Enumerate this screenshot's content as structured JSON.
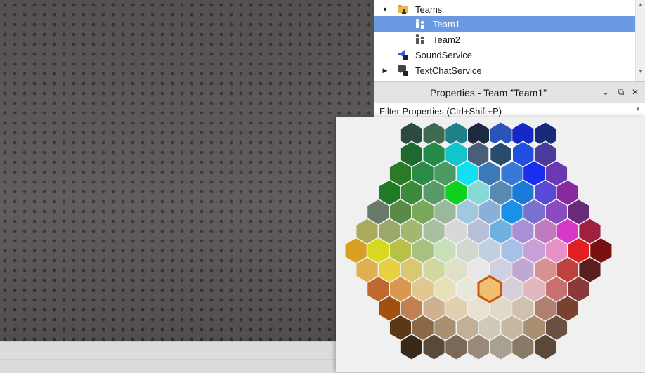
{
  "explorer": {
    "items": [
      {
        "label": "Teams",
        "icon": "teams-folder-icon",
        "expanded": true,
        "selected": false
      },
      {
        "label": "Team1",
        "icon": "team-icon",
        "expanded": null,
        "selected": true
      },
      {
        "label": "Team2",
        "icon": "team-icon",
        "expanded": null,
        "selected": false
      },
      {
        "label": "SoundService",
        "icon": "sound-service-icon",
        "expanded": null,
        "selected": false
      },
      {
        "label": "TextChatService",
        "icon": "text-chat-service-icon",
        "expanded": false,
        "selected": false
      }
    ]
  },
  "properties": {
    "title": "Properties - Team \"Team1\"",
    "filter_placeholder": "Filter Properties (Ctrl+Shift+P)"
  },
  "colors": {
    "selection": "#6b9ae2",
    "viewport": "#5b5558",
    "picker_selected": "#2a4a6e",
    "picker_hover": "#f0c070"
  },
  "color_picker": {
    "selected_swatch": "#2a4a6e",
    "hover_swatch": "#f0c070",
    "rows": [
      [
        "#2d4a3e",
        "#3d6a50",
        "#1f7f8a",
        "#1b2a3c",
        "#2a55b8",
        "#1428c8",
        "#1a2a7a"
      ],
      [
        "#1e6a2e",
        "#238a48",
        "#12c4cc",
        "#4a5e78",
        "#2a4a6e",
        "#2050e0",
        "#4a3a9a"
      ],
      [
        "#2a7a28",
        "#2a8a4a",
        "#4a9a62",
        "#10e0f0",
        "#3a7ab8",
        "#3a78d8",
        "#1a2ef0",
        "#6a38b0"
      ],
      [
        "#1e7a24",
        "#3a8a3a",
        "#5a9a6a",
        "#10d020",
        "#88d8d8",
        "#5a8ab0",
        "#1a7ad8",
        "#5a4ad8",
        "#8a2aa0"
      ],
      [
        "#6a7a6a",
        "#5a8a4a",
        "#7aa85a",
        "#9ab89a",
        "#a0c8e0",
        "#8ab0d8",
        "#1a90e8",
        "#7a70d0",
        "#8a4ac0",
        "#6a2a7a"
      ],
      [
        "#aaaa5a",
        "#9aa86a",
        "#a0b870",
        "#a8c0a0",
        "#d8d8d8",
        "#b8c0d8",
        "#70b0e0",
        "#a890d8",
        "#c07ac0",
        "#d838c8",
        "#a02040"
      ],
      [
        "#d8a020",
        "#d8d820",
        "#b8c048",
        "#a8c080",
        "#c8e0b8",
        "#d0d8d0",
        "#c0d0e0",
        "#a8c0e8",
        "#c8a0d8",
        "#e890c8",
        "#e02020",
        "#7a1010"
      ],
      [
        "#e0b050",
        "#e8d040",
        "#d8c870",
        "#d0d8a0",
        "#e0e0c8",
        "#e8e8e8",
        "#d0d0e0",
        "#c0a8d0",
        "#d89090",
        "#c04040",
        "#5a2020"
      ],
      [
        "#c06830",
        "#d89850",
        "#e0c890",
        "#e8e0b8",
        "#e8e8d8",
        "#f0c070",
        "#d8d0d8",
        "#e0b8c0",
        "#c87070",
        "#8a3a3a"
      ],
      [
        "#a05010",
        "#c08050",
        "#d0b090",
        "#e0d0b0",
        "#e8e0d0",
        "#e0d8c8",
        "#d0c0b0",
        "#b08070",
        "#7a4030"
      ],
      [
        "#5a3818",
        "#8a6848",
        "#a89070",
        "#c0b098",
        "#d0c8b8",
        "#c8b8a0",
        "#a89070",
        "#6a5040"
      ],
      [
        "#3a2818",
        "#5a4838",
        "#7a6858",
        "#9a8878",
        "#a8a090",
        "#8a7868",
        "#5a4838"
      ]
    ]
  }
}
